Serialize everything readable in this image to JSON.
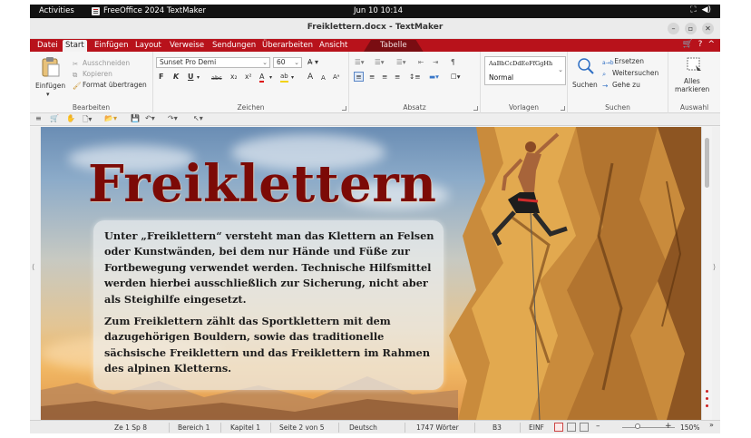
{
  "topbar": {
    "activities": "Activities",
    "app_name": "FreeOffice 2024 TextMaker",
    "clock": "Jun 10  10:14",
    "tray_icons": [
      "network-icon",
      "volume-icon"
    ]
  },
  "window": {
    "title": "Freiklettern.docx - TextMaker",
    "controls": [
      "–",
      "▫",
      "✕"
    ]
  },
  "menu": {
    "tabs": [
      "Datei",
      "Start",
      "Einfügen",
      "Layout",
      "Verweise",
      "Sendungen",
      "Überarbeiten",
      "Ansicht",
      "Tabelle"
    ],
    "active": "Start",
    "right_icons": [
      "🛒",
      "?",
      "^"
    ]
  },
  "ribbon": {
    "bearbeiten": {
      "paste": "Einfügen",
      "cut": "Ausschneiden",
      "copy": "Kopieren",
      "format_painter": "Format übertragen",
      "label": "Bearbeiten"
    },
    "zeichen": {
      "font": "Sunset Pro Demi",
      "size": "60",
      "bold": "F",
      "italic": "K",
      "underline": "U",
      "strike": "abc",
      "subscript": "x₂",
      "superscript": "x²",
      "font_color": "A",
      "highlight": "ab",
      "grow": "A",
      "shrink": "A",
      "label": "Zeichen"
    },
    "absatz": {
      "label": "Absatz",
      "pilcrow": "¶"
    },
    "vorlagen": {
      "preview": "AaBbCcDdEeFfGgHh",
      "style": "Normal",
      "label": "Vorlagen"
    },
    "suchen": {
      "search": "Suchen",
      "replace": "Ersetzen",
      "find_next": "Weitersuchen",
      "goto": "Gehe zu",
      "label": "Suchen"
    },
    "auswahl": {
      "select_all_1": "Alles",
      "select_all_2": "markieren",
      "label": "Auswahl"
    }
  },
  "document": {
    "heading": "Freiklettern",
    "paragraph1": "Unter „Freiklettern“ versteht man das Klettern an Felsen oder Kunstwänden, bei dem nur Hände und Füße zur Fortbewegung verwendet werden. Technische Hilfsmittel werden hierbei ausschließlich zur Sicherung, nicht aber als Steighilfe eingesetzt.",
    "paragraph2": "Zum Freiklettern zählt das Sportklettern mit dem dazugehörigen Bouldern, sowie das traditionelle sächsische Freiklettern und das Freiklettern im Rahmen des alpinen Kletterns.",
    "heading_color": "#7c0a06"
  },
  "status": {
    "position": "Ze 1 Sp 8",
    "area": "Bereich 1",
    "chapter": "Kapitel 1",
    "page": "Seite 2 von 5",
    "language": "Deutsch",
    "words": "1747 Wörter",
    "cell": "B3",
    "mode": "EINF",
    "zoom": "150%"
  },
  "colors": {
    "accent": "#b8121b",
    "topbar": "#121212"
  }
}
